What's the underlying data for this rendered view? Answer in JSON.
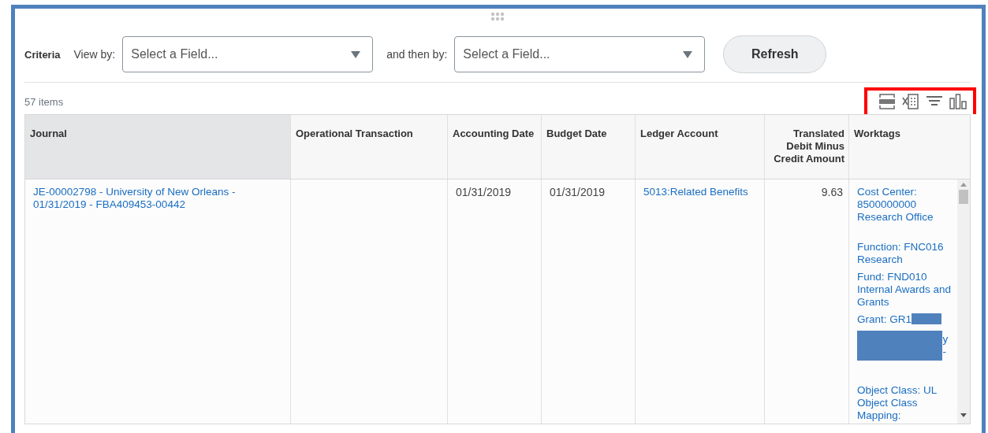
{
  "criteria": {
    "title": "Criteria",
    "view_by": {
      "label": "View by:",
      "placeholder": "Select a Field..."
    },
    "then_by": {
      "label": "and then by:",
      "placeholder": "Select a Field..."
    },
    "refresh": "Refresh"
  },
  "count": "57 items",
  "toolbar": {
    "highlighted": true
  },
  "table": {
    "columns": [
      {
        "label": "Journal",
        "selected": true
      },
      {
        "label": "Operational Transaction",
        "selected": false
      },
      {
        "label": "Accounting Date",
        "selected": false
      },
      {
        "label": "Budget Date",
        "selected": false
      },
      {
        "label": "Ledger Account",
        "selected": false
      },
      {
        "label": "Translated Debit Minus Credit Amount",
        "selected": false
      },
      {
        "label": "Worktags",
        "selected": false
      }
    ],
    "row": {
      "journal": "JE-00002798 - University of New Orleans - 01/31/2019 - FBA409453-00442",
      "accounting_date": "01/31/2019",
      "budget_date": "01/31/2019",
      "ledger_account": "5013:Related Benefits",
      "amount": "9.63",
      "worktags": [
        {
          "label": "Cost Center: 8500000000 Research Office",
          "redacted": false
        },
        {
          "label": "Function: FNC016 Research",
          "redacted": false
        },
        {
          "label": "Fund: FND010 Internal Awards and Grants",
          "redacted": false
        },
        {
          "label": "Grant: GR1",
          "redacted": true,
          "tail": "y -"
        },
        {
          "label": "Object Class: UL Object Class Mapping:",
          "redacted": false
        }
      ]
    }
  }
}
